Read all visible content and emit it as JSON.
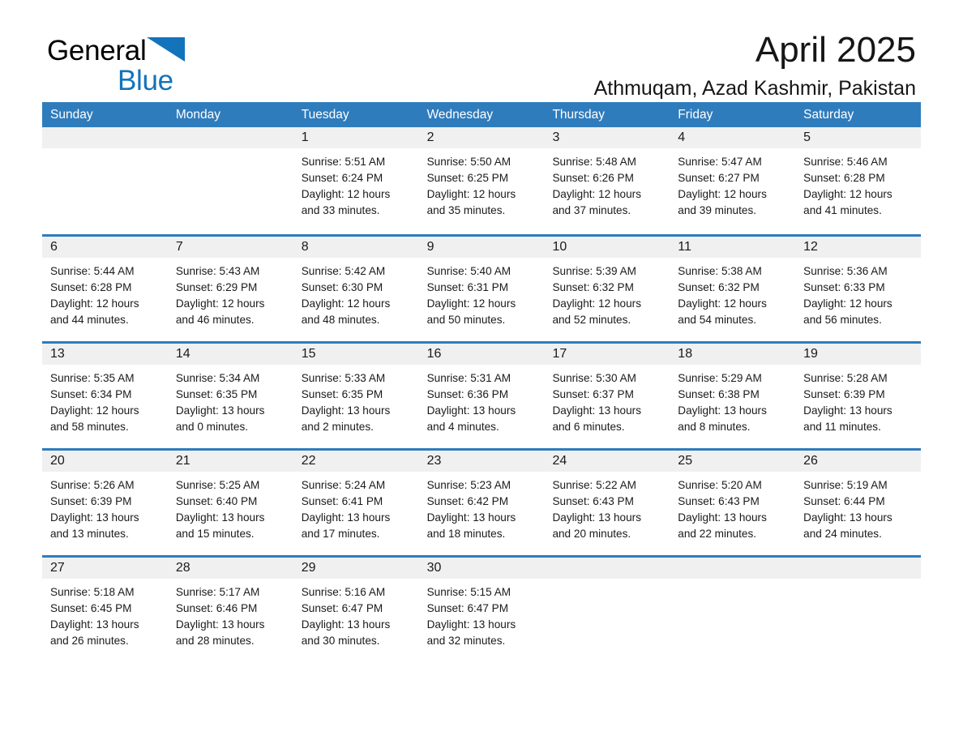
{
  "brand": {
    "word1": "General",
    "word2": "Blue",
    "triangle_color": "#1373bb",
    "logo_icon": "general-blue-triangle-icon"
  },
  "header": {
    "month_title": "April 2025",
    "location": "Athmuqam, Azad Kashmir, Pakistan"
  },
  "theme": {
    "header_blue": "#2f7cbd",
    "day_band_gray": "#f0f0f0",
    "text_color": "#1a1a1a"
  },
  "calendar": {
    "weekdays": [
      "Sunday",
      "Monday",
      "Tuesday",
      "Wednesday",
      "Thursday",
      "Friday",
      "Saturday"
    ],
    "weeks": [
      [
        {
          "day": "",
          "empty": true
        },
        {
          "day": "",
          "empty": true
        },
        {
          "day": "1",
          "sunrise": "Sunrise: 5:51 AM",
          "sunset": "Sunset: 6:24 PM",
          "daylight1": "Daylight: 12 hours",
          "daylight2": "and 33 minutes."
        },
        {
          "day": "2",
          "sunrise": "Sunrise: 5:50 AM",
          "sunset": "Sunset: 6:25 PM",
          "daylight1": "Daylight: 12 hours",
          "daylight2": "and 35 minutes."
        },
        {
          "day": "3",
          "sunrise": "Sunrise: 5:48 AM",
          "sunset": "Sunset: 6:26 PM",
          "daylight1": "Daylight: 12 hours",
          "daylight2": "and 37 minutes."
        },
        {
          "day": "4",
          "sunrise": "Sunrise: 5:47 AM",
          "sunset": "Sunset: 6:27 PM",
          "daylight1": "Daylight: 12 hours",
          "daylight2": "and 39 minutes."
        },
        {
          "day": "5",
          "sunrise": "Sunrise: 5:46 AM",
          "sunset": "Sunset: 6:28 PM",
          "daylight1": "Daylight: 12 hours",
          "daylight2": "and 41 minutes."
        }
      ],
      [
        {
          "day": "6",
          "sunrise": "Sunrise: 5:44 AM",
          "sunset": "Sunset: 6:28 PM",
          "daylight1": "Daylight: 12 hours",
          "daylight2": "and 44 minutes."
        },
        {
          "day": "7",
          "sunrise": "Sunrise: 5:43 AM",
          "sunset": "Sunset: 6:29 PM",
          "daylight1": "Daylight: 12 hours",
          "daylight2": "and 46 minutes."
        },
        {
          "day": "8",
          "sunrise": "Sunrise: 5:42 AM",
          "sunset": "Sunset: 6:30 PM",
          "daylight1": "Daylight: 12 hours",
          "daylight2": "and 48 minutes."
        },
        {
          "day": "9",
          "sunrise": "Sunrise: 5:40 AM",
          "sunset": "Sunset: 6:31 PM",
          "daylight1": "Daylight: 12 hours",
          "daylight2": "and 50 minutes."
        },
        {
          "day": "10",
          "sunrise": "Sunrise: 5:39 AM",
          "sunset": "Sunset: 6:32 PM",
          "daylight1": "Daylight: 12 hours",
          "daylight2": "and 52 minutes."
        },
        {
          "day": "11",
          "sunrise": "Sunrise: 5:38 AM",
          "sunset": "Sunset: 6:32 PM",
          "daylight1": "Daylight: 12 hours",
          "daylight2": "and 54 minutes."
        },
        {
          "day": "12",
          "sunrise": "Sunrise: 5:36 AM",
          "sunset": "Sunset: 6:33 PM",
          "daylight1": "Daylight: 12 hours",
          "daylight2": "and 56 minutes."
        }
      ],
      [
        {
          "day": "13",
          "sunrise": "Sunrise: 5:35 AM",
          "sunset": "Sunset: 6:34 PM",
          "daylight1": "Daylight: 12 hours",
          "daylight2": "and 58 minutes."
        },
        {
          "day": "14",
          "sunrise": "Sunrise: 5:34 AM",
          "sunset": "Sunset: 6:35 PM",
          "daylight1": "Daylight: 13 hours",
          "daylight2": "and 0 minutes."
        },
        {
          "day": "15",
          "sunrise": "Sunrise: 5:33 AM",
          "sunset": "Sunset: 6:35 PM",
          "daylight1": "Daylight: 13 hours",
          "daylight2": "and 2 minutes."
        },
        {
          "day": "16",
          "sunrise": "Sunrise: 5:31 AM",
          "sunset": "Sunset: 6:36 PM",
          "daylight1": "Daylight: 13 hours",
          "daylight2": "and 4 minutes."
        },
        {
          "day": "17",
          "sunrise": "Sunrise: 5:30 AM",
          "sunset": "Sunset: 6:37 PM",
          "daylight1": "Daylight: 13 hours",
          "daylight2": "and 6 minutes."
        },
        {
          "day": "18",
          "sunrise": "Sunrise: 5:29 AM",
          "sunset": "Sunset: 6:38 PM",
          "daylight1": "Daylight: 13 hours",
          "daylight2": "and 8 minutes."
        },
        {
          "day": "19",
          "sunrise": "Sunrise: 5:28 AM",
          "sunset": "Sunset: 6:39 PM",
          "daylight1": "Daylight: 13 hours",
          "daylight2": "and 11 minutes."
        }
      ],
      [
        {
          "day": "20",
          "sunrise": "Sunrise: 5:26 AM",
          "sunset": "Sunset: 6:39 PM",
          "daylight1": "Daylight: 13 hours",
          "daylight2": "and 13 minutes."
        },
        {
          "day": "21",
          "sunrise": "Sunrise: 5:25 AM",
          "sunset": "Sunset: 6:40 PM",
          "daylight1": "Daylight: 13 hours",
          "daylight2": "and 15 minutes."
        },
        {
          "day": "22",
          "sunrise": "Sunrise: 5:24 AM",
          "sunset": "Sunset: 6:41 PM",
          "daylight1": "Daylight: 13 hours",
          "daylight2": "and 17 minutes."
        },
        {
          "day": "23",
          "sunrise": "Sunrise: 5:23 AM",
          "sunset": "Sunset: 6:42 PM",
          "daylight1": "Daylight: 13 hours",
          "daylight2": "and 18 minutes."
        },
        {
          "day": "24",
          "sunrise": "Sunrise: 5:22 AM",
          "sunset": "Sunset: 6:43 PM",
          "daylight1": "Daylight: 13 hours",
          "daylight2": "and 20 minutes."
        },
        {
          "day": "25",
          "sunrise": "Sunrise: 5:20 AM",
          "sunset": "Sunset: 6:43 PM",
          "daylight1": "Daylight: 13 hours",
          "daylight2": "and 22 minutes."
        },
        {
          "day": "26",
          "sunrise": "Sunrise: 5:19 AM",
          "sunset": "Sunset: 6:44 PM",
          "daylight1": "Daylight: 13 hours",
          "daylight2": "and 24 minutes."
        }
      ],
      [
        {
          "day": "27",
          "sunrise": "Sunrise: 5:18 AM",
          "sunset": "Sunset: 6:45 PM",
          "daylight1": "Daylight: 13 hours",
          "daylight2": "and 26 minutes."
        },
        {
          "day": "28",
          "sunrise": "Sunrise: 5:17 AM",
          "sunset": "Sunset: 6:46 PM",
          "daylight1": "Daylight: 13 hours",
          "daylight2": "and 28 minutes."
        },
        {
          "day": "29",
          "sunrise": "Sunrise: 5:16 AM",
          "sunset": "Sunset: 6:47 PM",
          "daylight1": "Daylight: 13 hours",
          "daylight2": "and 30 minutes."
        },
        {
          "day": "30",
          "sunrise": "Sunrise: 5:15 AM",
          "sunset": "Sunset: 6:47 PM",
          "daylight1": "Daylight: 13 hours",
          "daylight2": "and 32 minutes."
        },
        {
          "day": "",
          "empty": true
        },
        {
          "day": "",
          "empty": true
        },
        {
          "day": "",
          "empty": true
        }
      ]
    ]
  }
}
